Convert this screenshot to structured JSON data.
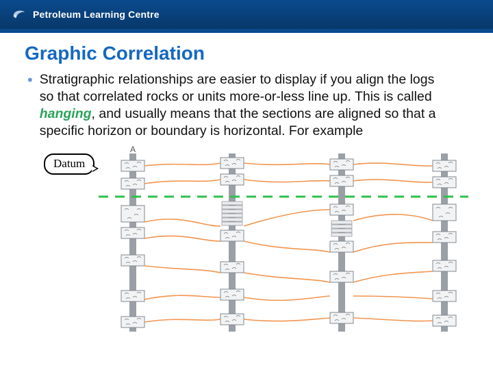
{
  "header": {
    "brand": "Petroleum Learning Centre"
  },
  "slide": {
    "title": "Graphic Correlation",
    "bullet_pre": "Stratigraphic relationships are easier to display if you align the logs so that correlated rocks or units more-or-less line up. This is called ",
    "hanging": "hanging",
    "bullet_post": ", and usually means that the sections are aligned so that a specific horizon or boundary is horizontal. For example",
    "datum_label": "Datum",
    "section_a_label": "A"
  },
  "colors": {
    "header_bg": "#0a4a8e",
    "title": "#1568c1",
    "accent_green": "#2aa35a",
    "datum_line": "#2fbf4a",
    "corr_line": "#f2944f"
  }
}
